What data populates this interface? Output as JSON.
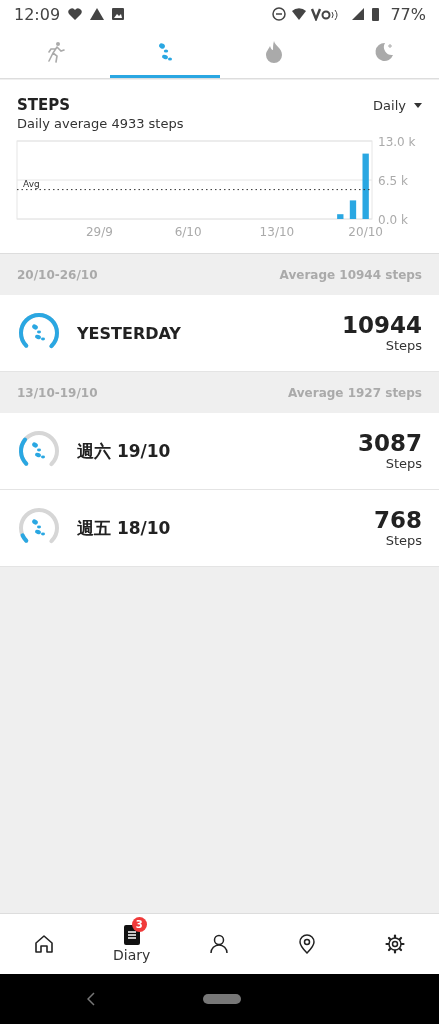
{
  "status_bar": {
    "time": "12:09",
    "battery": "77%"
  },
  "tabs": [
    {
      "kind": "run",
      "selected": false
    },
    {
      "kind": "steps",
      "selected": true
    },
    {
      "kind": "flame",
      "selected": false
    },
    {
      "kind": "moon",
      "selected": false
    }
  ],
  "summary": {
    "title": "STEPS",
    "period": "Daily",
    "subtitle": "Daily average 4933 steps",
    "chart_data": {
      "type": "bar",
      "categories": [
        null,
        null,
        null,
        null,
        null,
        null,
        "29/9",
        null,
        null,
        null,
        null,
        null,
        null,
        "6/10",
        null,
        null,
        null,
        null,
        null,
        null,
        "13/10",
        null,
        null,
        null,
        null,
        null,
        null,
        "20/10"
      ],
      "values": [
        null,
        null,
        null,
        null,
        null,
        null,
        null,
        null,
        null,
        null,
        null,
        null,
        null,
        null,
        null,
        null,
        null,
        null,
        null,
        null,
        null,
        null,
        null,
        null,
        null,
        800,
        3100,
        10900
      ],
      "ylim": [
        0,
        13000
      ],
      "yticks": [
        {
          "value": 0,
          "label": "0.0 k"
        },
        {
          "value": 6500,
          "label": "6.5 k"
        },
        {
          "value": 13000,
          "label": "13.0 k"
        }
      ],
      "ref_lines": [
        {
          "axis": "y",
          "value": 4900,
          "label": "Avg"
        }
      ]
    }
  },
  "weeks": [
    {
      "range": "20/10-26/10",
      "average": "Average 10944 steps",
      "days": [
        {
          "label": "YESTERDAY",
          "steps": "10944",
          "unit": "Steps"
        }
      ]
    },
    {
      "range": "13/10-19/10",
      "average": "Average 1927 steps",
      "days": [
        {
          "label": "週六 19/10",
          "steps": "3087",
          "unit": "Steps"
        },
        {
          "label": "週五 18/10",
          "steps": "768",
          "unit": "Steps"
        }
      ]
    }
  ],
  "bottom_nav": [
    {
      "kind": "home"
    },
    {
      "kind": "diary",
      "label": "Diary",
      "badge": "3"
    },
    {
      "kind": "profile"
    },
    {
      "kind": "places"
    },
    {
      "kind": "settings"
    }
  ]
}
